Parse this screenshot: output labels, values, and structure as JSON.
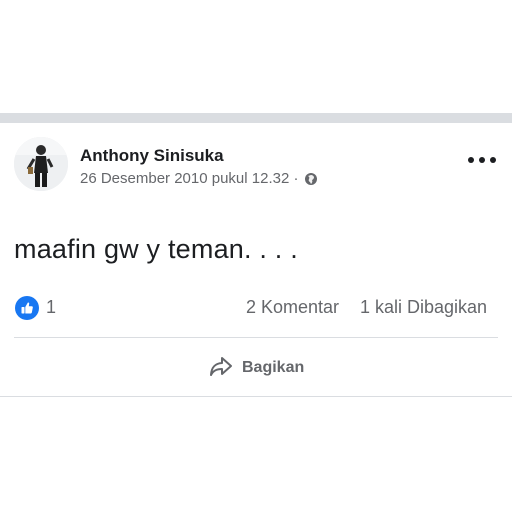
{
  "post": {
    "author": "Anthony Sinisuka",
    "timestamp": "26 Desember 2010 pukul 12.32 ·",
    "audience_icon": "globe-icon",
    "text": "maafin gw y teman. . . .",
    "reaction_icon": "like-icon",
    "reaction_count": "1",
    "comments_label": "2 Komentar",
    "shares_label": "1 kali Dibagikan",
    "share_button_label": "Bagikan",
    "accent_color": "#1877f2"
  }
}
